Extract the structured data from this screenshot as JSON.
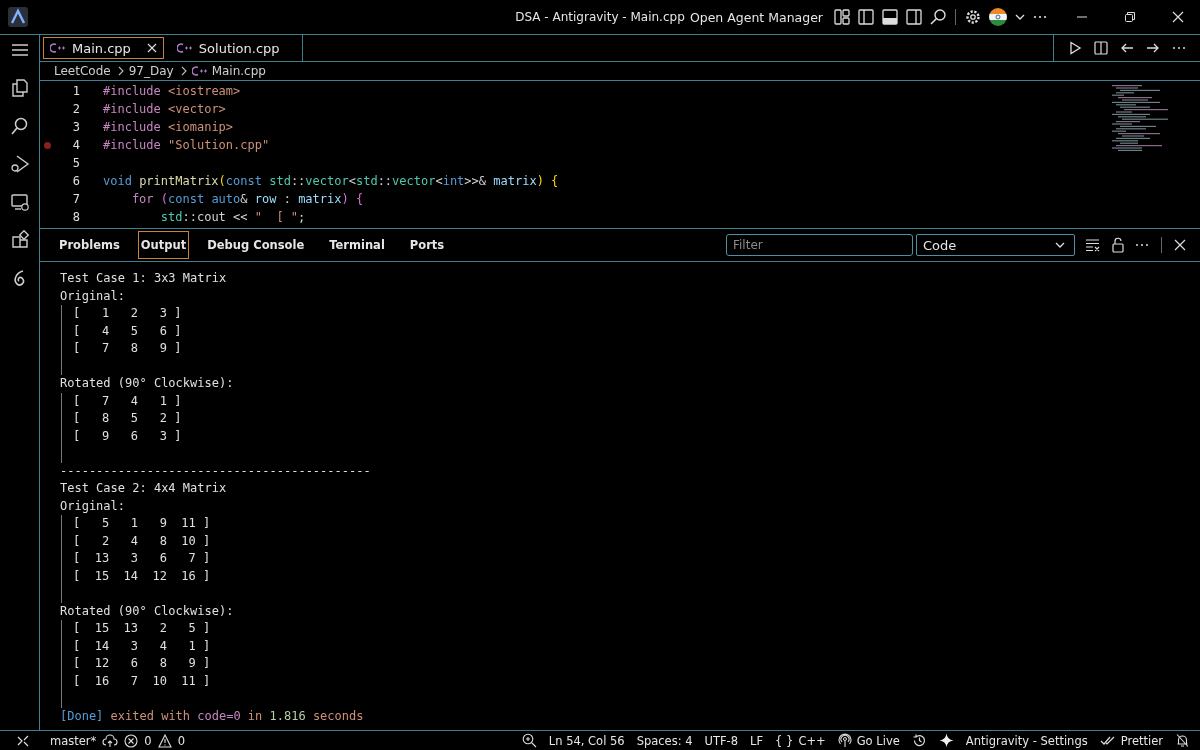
{
  "window": {
    "title": "DSA - Antigravity - Main.cpp",
    "agent_manager": "Open Agent Manager"
  },
  "editor_tabs": [
    {
      "label": "Main.cpp",
      "selected": true
    },
    {
      "label": "Solution.cpp",
      "selected": false
    }
  ],
  "breadcrumb": [
    "LeetCode",
    "97_Day",
    "Main.cpp"
  ],
  "code_lines": [
    {
      "number": "1",
      "breakpoint": false,
      "tokens": [
        {
          "text": "#include ",
          "kind": "directive"
        },
        {
          "text": "<iostream>",
          "kind": "string"
        }
      ]
    },
    {
      "number": "2",
      "breakpoint": false,
      "tokens": [
        {
          "text": "#include ",
          "kind": "directive"
        },
        {
          "text": "<vector>",
          "kind": "string"
        }
      ]
    },
    {
      "number": "3",
      "breakpoint": false,
      "tokens": [
        {
          "text": "#include ",
          "kind": "directive"
        },
        {
          "text": "<iomanip>",
          "kind": "string"
        }
      ]
    },
    {
      "number": "4",
      "breakpoint": true,
      "tokens": [
        {
          "text": "#include ",
          "kind": "directive"
        },
        {
          "text": "\"Solution.cpp\"",
          "kind": "string"
        }
      ]
    },
    {
      "number": "5",
      "breakpoint": false
    },
    {
      "number": "6",
      "breakpoint": false,
      "tokens": [
        {
          "text": "void ",
          "kind": "keyword"
        },
        {
          "text": "printMatrix",
          "kind": "function"
        },
        {
          "text": "(",
          "kind": "brace"
        },
        {
          "text": "const ",
          "kind": "keyword"
        },
        {
          "text": "std",
          "kind": "type"
        },
        {
          "text": "::",
          "kind": "plain"
        },
        {
          "text": "vector",
          "kind": "type"
        },
        {
          "text": "<",
          "kind": "plain"
        },
        {
          "text": "std",
          "kind": "type"
        },
        {
          "text": "::",
          "kind": "plain"
        },
        {
          "text": "vector",
          "kind": "type"
        },
        {
          "text": "<",
          "kind": "plain"
        },
        {
          "text": "int",
          "kind": "keyword"
        },
        {
          "text": ">>& ",
          "kind": "plain"
        },
        {
          "text": "matrix",
          "kind": "variable"
        },
        {
          "text": ") {",
          "kind": "brace"
        }
      ]
    },
    {
      "number": "7",
      "breakpoint": false,
      "tokens": [
        {
          "text": "    for ",
          "kind": "control"
        },
        {
          "text": "(",
          "kind": "paren"
        },
        {
          "text": "const ",
          "kind": "keyword"
        },
        {
          "text": "auto",
          "kind": "keyword"
        },
        {
          "text": "& ",
          "kind": "plain"
        },
        {
          "text": "row",
          "kind": "variable"
        },
        {
          "text": " : ",
          "kind": "plain"
        },
        {
          "text": "matrix",
          "kind": "variable"
        },
        {
          "text": ") {",
          "kind": "paren"
        }
      ]
    },
    {
      "number": "8",
      "breakpoint": false,
      "tokens": [
        {
          "text": "        std",
          "kind": "type"
        },
        {
          "text": "::cout << ",
          "kind": "plain"
        },
        {
          "text": "\"  [ \"",
          "kind": "string"
        },
        {
          "text": ";",
          "kind": "plain"
        }
      ]
    }
  ],
  "panel_tabs": [
    {
      "label": "Problems",
      "selected": false
    },
    {
      "label": "Output",
      "selected": true
    },
    {
      "label": "Debug Console",
      "selected": false
    },
    {
      "label": "Terminal",
      "selected": false
    },
    {
      "label": "Ports",
      "selected": false
    }
  ],
  "filter": {
    "placeholder": "Filter"
  },
  "output_channel": "Code",
  "output_lines": [
    {
      "kind": "text",
      "guide": false,
      "text": "Test Case 1: 3x3 Matrix"
    },
    {
      "kind": "text",
      "guide": false,
      "text": "Original:"
    },
    {
      "kind": "text",
      "guide": true,
      "text": "[   1   2   3 ]"
    },
    {
      "kind": "text",
      "guide": true,
      "text": "[   4   5   6 ]"
    },
    {
      "kind": "text",
      "guide": true,
      "text": "[   7   8   9 ]"
    },
    {
      "kind": "blank",
      "guide": true
    },
    {
      "kind": "text",
      "guide": false,
      "text": "Rotated (90° Clockwise):"
    },
    {
      "kind": "text",
      "guide": true,
      "text": "[   7   4   1 ]"
    },
    {
      "kind": "text",
      "guide": true,
      "text": "[   8   5   2 ]"
    },
    {
      "kind": "text",
      "guide": true,
      "text": "[   9   6   3 ]"
    },
    {
      "kind": "blank",
      "guide": true
    },
    {
      "kind": "text",
      "guide": false,
      "text": "-------------------------------------------"
    },
    {
      "kind": "text",
      "guide": false,
      "text": "Test Case 2: 4x4 Matrix"
    },
    {
      "kind": "text",
      "guide": false,
      "text": "Original:"
    },
    {
      "kind": "text",
      "guide": true,
      "text": "[   5   1   9  11 ]"
    },
    {
      "kind": "text",
      "guide": true,
      "text": "[   2   4   8  10 ]"
    },
    {
      "kind": "text",
      "guide": true,
      "text": "[  13   3   6   7 ]"
    },
    {
      "kind": "text",
      "guide": true,
      "text": "[  15  14  12  16 ]"
    },
    {
      "kind": "blank",
      "guide": true
    },
    {
      "kind": "text",
      "guide": false,
      "text": "Rotated (90° Clockwise):"
    },
    {
      "kind": "text",
      "guide": true,
      "text": "[  15  13   2   5 ]"
    },
    {
      "kind": "text",
      "guide": true,
      "text": "[  14   3   4   1 ]"
    },
    {
      "kind": "text",
      "guide": true,
      "text": "[  12   6   8   9 ]"
    },
    {
      "kind": "text",
      "guide": true,
      "text": "[  16   7  10  11 ]"
    },
    {
      "kind": "blank",
      "guide": true
    },
    {
      "kind": "rich",
      "guide": false,
      "tokens": [
        {
          "text": "[Done]",
          "kind": "done"
        },
        {
          "text": " exited with ",
          "kind": "message"
        },
        {
          "text": "code=0",
          "kind": "code"
        },
        {
          "text": " in ",
          "kind": "message"
        },
        {
          "text": "1.816",
          "kind": "number"
        },
        {
          "text": " seconds",
          "kind": "message"
        }
      ]
    }
  ],
  "status_bar": {
    "branch": "master*",
    "errors": "0",
    "warnings": "0",
    "position": "Ln 54, Col 56",
    "indent": "Spaces: 4",
    "encoding": "UTF-8",
    "eol": "LF",
    "language_glyph": "{ }",
    "language": "C++",
    "live": "Go Live",
    "settings": "Antigravity - Settings",
    "formatter": "Prettier"
  }
}
